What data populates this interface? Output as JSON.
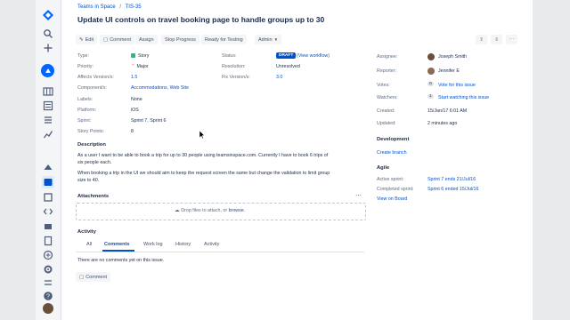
{
  "colors": {
    "accent": "#0052cc",
    "draft_badge": "#0052cc",
    "rail": "#f4f5f7",
    "logo": "#0065ff"
  },
  "rail_icons": [
    "jira-logo",
    "search-icon",
    "plus-icon",
    "project-avatar",
    "board-icon",
    "backlog-icon",
    "list-icon",
    "reports-icon",
    "releases-icon",
    "issues-icon",
    "components-icon",
    "code-icon",
    "ship-icon",
    "pages-icon",
    "add-item-icon",
    "settings-icon",
    "help-icon",
    "profile-icon"
  ],
  "breadcrumb": {
    "project": "Teams in Space",
    "sep": "/",
    "issue_key": "TIS-35"
  },
  "issue": {
    "title": "Update UI controls on travel booking page to handle groups up to 30"
  },
  "toolbar": {
    "edit": "Edit",
    "comment": "Comment",
    "assign": "Assign",
    "stop_progress": "Stop Progress",
    "ready_for_testing": "Ready for Testing",
    "admin": "Admin"
  },
  "details": {
    "type_label": "Type:",
    "type_value": "Story",
    "priority_label": "Priority:",
    "priority_value": "Major",
    "affects_label": "Affects Version/s:",
    "affects_value": "1.5",
    "components_label": "Component/s:",
    "components_value": "Accommodations, Web Site",
    "labels_label": "Labels:",
    "labels_value": "None",
    "platform_label": "Platform:",
    "platform_value": "iOS",
    "sprint_label": "Sprint:",
    "sprint_value": "Sprint 7, Sprint 6",
    "points_label": "Story Points:",
    "points_value": "8",
    "status_label": "Status:",
    "status_value": "DRAFT",
    "workflow_link": "(View workflow)",
    "resolution_label": "Resolution:",
    "resolution_value": "Unresolved",
    "fix_label": "Fix Version/s:",
    "fix_value": "3.0"
  },
  "description": {
    "heading": "Description",
    "line1": "As a user I want to be able to book a trip for up to 30 people using teamsinspace.com. Currently I have to book 6 trips of",
    "line2": "six people each.",
    "line3": "When booking a trip in the UI we should aim to keep the request screen the same but change the validation to limit group",
    "line4": "size to 40."
  },
  "attachments": {
    "heading": "Attachments",
    "drop_text": "Drop files to attach, or",
    "browse": "browse."
  },
  "activity": {
    "heading": "Activity",
    "tabs": [
      "All",
      "Comments",
      "Work log",
      "History",
      "Activity"
    ],
    "empty": "There are no comments yet on this issue.",
    "comment_button": "Comment"
  },
  "people": {
    "assignee_label": "Assignee:",
    "assignee": "Joseph Smith",
    "reporter_label": "Reporter:",
    "reporter": "Jennifer E",
    "votes_label": "Votes:",
    "votes_count": "0",
    "votes_link": "Vote for this issue",
    "watchers_label": "Watchers:",
    "watchers_count": "1",
    "watchers_link": "Start watching this issue",
    "created_label": "Created:",
    "created": "15/Jan/17 6:01 AM",
    "updated_label": "Updated:",
    "updated": "2 minutes ago"
  },
  "development": {
    "heading": "Development",
    "create_branch": "Create branch"
  },
  "agile": {
    "heading": "Agile",
    "active_label": "Active sprint:",
    "active_value": "Sprint 7 ends 21/Jul/16",
    "completed_label": "Completed sprint:",
    "completed_value": "Sprint 6 ended 15/Jul/16",
    "board_link": "View on Board"
  }
}
